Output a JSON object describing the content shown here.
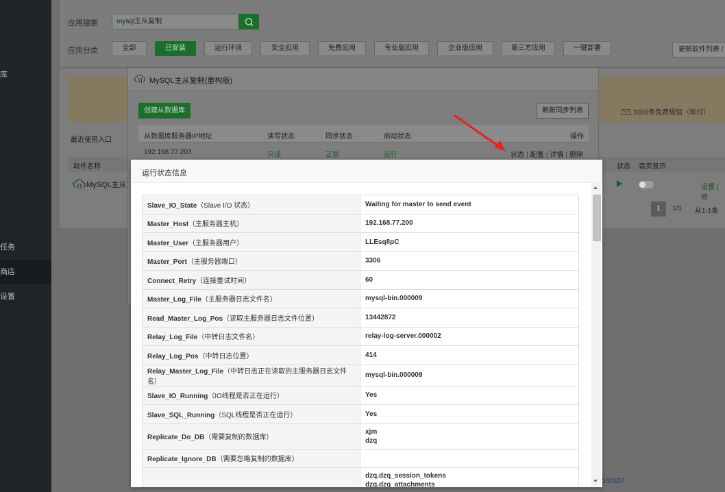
{
  "sidebar": {
    "items": [
      {
        "label": "库"
      },
      {
        "label": "任务"
      },
      {
        "label": "商店"
      },
      {
        "label": "设置"
      }
    ]
  },
  "store": {
    "search_label": "应用搜索",
    "search_value": "mysql主从复制",
    "category_label": "应用分类",
    "categories": [
      "全部",
      "已安装",
      "运行环境",
      "安全应用",
      "免费应用",
      "专业版应用",
      "企业版应用",
      "第三方应用",
      "一键部署"
    ],
    "refresh_list": "更新软件列表 /",
    "sms": "1000条免费短信（年付）",
    "recent": "最近使用入口",
    "col_software": "软件名称",
    "col_status": "状态",
    "col_home": "首页显示",
    "row_name": "MySQL主从复",
    "row_setting": "设置 | 修",
    "pager_current": "1",
    "pager_total": "1/1",
    "pager_range": "从1-1条",
    "corner_num": "340327"
  },
  "dialog": {
    "title": "MySQL主从复制(重构版)",
    "create_button": "创建从数据库",
    "refresh_sync_button": "刷新同步列表",
    "headers": {
      "ip": "从数据库服务器IP地址",
      "rw": "读写状态",
      "sync": "同步状态",
      "start": "启动状态",
      "ops": "操作"
    },
    "row": {
      "ip": "192.168.77.203",
      "rw": "只读",
      "sync": "正常",
      "start": "运行",
      "op_status": "状态",
      "op_config": "配置",
      "op_detail": "详情",
      "op_delete": "删除"
    }
  },
  "modal": {
    "title": "运行状态信息",
    "rows": [
      {
        "key": "Slave_IO_State",
        "hint": "（Slave I/O 状态）",
        "value": "Waiting for master to send event"
      },
      {
        "key": "Master_Host",
        "hint": "（主服务器主机）",
        "value": "192.168.77.200"
      },
      {
        "key": "Master_User",
        "hint": "（主服务器用户）",
        "value": "LLEsq8pC"
      },
      {
        "key": "Master_Port",
        "hint": "（主服务器端口）",
        "value": "3306"
      },
      {
        "key": "Connect_Retry",
        "hint": "（连接重试时间）",
        "value": "60"
      },
      {
        "key": "Master_Log_File",
        "hint": "（主服务器日志文件名）",
        "value": "mysql-bin.000009"
      },
      {
        "key": "Read_Master_Log_Pos",
        "hint": "（读取主服务器日志文件位置）",
        "value": "13442872"
      },
      {
        "key": "Relay_Log_File",
        "hint": "（中转日志文件名）",
        "value": "relay-log-server.000002"
      },
      {
        "key": "Relay_Log_Pos",
        "hint": "（中转日志位置）",
        "value": "414"
      },
      {
        "key": "Relay_Master_Log_File",
        "hint": "（中转日志正在读取的主服务器日志文件名）",
        "value": "mysql-bin.000009"
      },
      {
        "key": "Slave_IO_Running",
        "hint": "（IO线程是否正在运行）",
        "value": "Yes"
      },
      {
        "key": "Slave_SQL_Running",
        "hint": "（SQL线程是否正在运行）",
        "value": "Yes"
      },
      {
        "key": "Replicate_Do_DB",
        "hint": "（需要复制的数据库）",
        "value1": "xjm",
        "value2": "dzq"
      },
      {
        "key": "Replicate_Ignore_DB",
        "hint": "（需要忽略复制的数据库）",
        "value": ""
      },
      {
        "key": "",
        "hint": "",
        "value1": "dzq.dzq_session_tokens",
        "value2": "dzq.dzq_attachments"
      }
    ]
  },
  "colors": {
    "accent": "#20a53a",
    "sidebar_bg": "#1f2426",
    "arrow": "#e8211b"
  }
}
